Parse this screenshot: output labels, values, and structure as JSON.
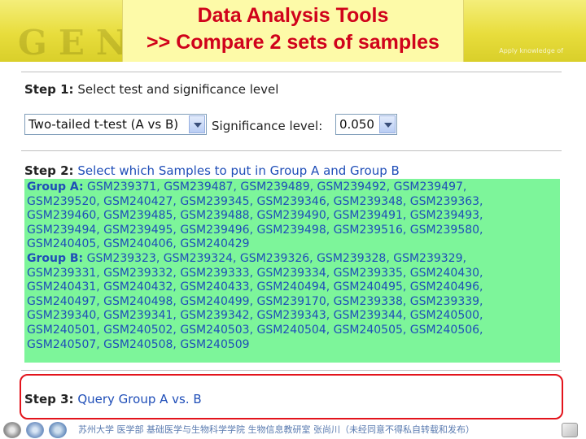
{
  "header": {
    "title_line1": "Data Analysis Tools",
    "title_line2": ">> Compare 2 sets of samples",
    "watermark": "GENE",
    "watermark_small": "Apply knowledge of"
  },
  "step1": {
    "label": "Step 1:",
    "text": "Select test and significance level",
    "test_select": {
      "value": "Two-tailed t-test (A vs B)"
    },
    "significance_label": "Significance level:",
    "significance_select": {
      "value": "0.050"
    }
  },
  "step2": {
    "label": "Step 2:",
    "text": "Select which Samples to put in Group A and Group B",
    "group_a_label": "Group A:",
    "group_b_label": "Group B:",
    "lines": [
      "GSM239371, GSM239487, GSM239489, GSM239492, GSM239497,",
      "GSM239520, GSM240427, GSM239345, GSM239346, GSM239348, GSM239363,",
      "GSM239460, GSM239485, GSM239488, GSM239490, GSM239491, GSM239493,",
      "GSM239494, GSM239495, GSM239496, GSM239498, GSM239516, GSM239580,",
      "GSM240405, GSM240406, GSM240429",
      "GSM239323, GSM239324, GSM239326, GSM239328, GSM239329,",
      "GSM239331, GSM239332, GSM239333, GSM239334, GSM239335, GSM240430,",
      "GSM240431, GSM240432, GSM240433, GSM240494, GSM240495, GSM240496,",
      "GSM240497, GSM240498, GSM240499, GSM239170, GSM239338, GSM239339,",
      "GSM239340, GSM239341, GSM239342, GSM239343, GSM239344, GSM240500,",
      "GSM240501, GSM240502, GSM240503, GSM240504, GSM240505, GSM240506,",
      "GSM240507, GSM240508, GSM240509"
    ]
  },
  "step3": {
    "label": "Step 3:",
    "link": "Query Group A vs. B"
  },
  "footer": {
    "text": "苏州大学 医学部 基础医学与生物科学学院 生物信息教研室 张尚川（未经同意不得私自转载和发布）"
  },
  "colors": {
    "title_red": "#d0021b",
    "banner_yellow": "#e8dd3c",
    "link_blue": "#1f4eb8",
    "group_green": "#7df59a",
    "highlight_red": "#e3141c"
  }
}
